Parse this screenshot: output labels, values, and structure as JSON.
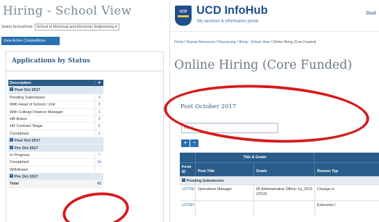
{
  "left": {
    "title": "Hiring - School View",
    "school_label": "Select School/Unit:",
    "school_value": "School of Electrical and Electronic Engineering",
    "view_active_button": "View Active Competitions",
    "apps_heading": "Applications by Status",
    "table": {
      "col_description": "Description",
      "col_count": "#",
      "rows": [
        {
          "type": "group",
          "label": "Post Oct 2017",
          "count": ""
        },
        {
          "type": "item",
          "label": "Pending Submission",
          "count": "3"
        },
        {
          "type": "item",
          "label": "With Head of School / Unit",
          "count": "3"
        },
        {
          "type": "item",
          "label": "With College Finance Manager",
          "count": "1"
        },
        {
          "type": "item",
          "label": "HR Active",
          "count": "3"
        },
        {
          "type": "item",
          "label": "HR Contract Stage",
          "count": "6"
        },
        {
          "type": "item",
          "label": "Completed",
          "count": "1"
        },
        {
          "type": "group",
          "label": "Post Oct 2017",
          "count": ""
        },
        {
          "type": "group",
          "label": "Pre Oct 2017",
          "count": ""
        },
        {
          "type": "item",
          "label": "In Progress",
          "count": "7"
        },
        {
          "type": "item",
          "label": "Completed",
          "count": "15"
        },
        {
          "type": "item",
          "label": "Withdrawn",
          "count": ""
        },
        {
          "type": "group",
          "label": "Pre Oct 2017",
          "count": ""
        },
        {
          "type": "total",
          "label": "Total",
          "count": "42"
        }
      ]
    }
  },
  "right": {
    "brand": "UCD InfoHub",
    "tagline": "My services & information portal",
    "crest_text": "UCD",
    "top_link": "Stud",
    "breadcrumb": {
      "home": "Home",
      "hr": "Human Resources",
      "resourcing": "Resourcing",
      "school_view": "Hiring - School View",
      "current": "Online Hiring (Core Funded)",
      "separator": "/"
    },
    "page_title": "Online Hiring (Core Funded)",
    "section_heading": "Post October 2017",
    "filter_placeholder": "Filter...",
    "buttons": {
      "expand": "+",
      "collapse": "−"
    },
    "table": {
      "title_header": "Title & Grade",
      "col_form_id": "Form ID",
      "col_post_title": "Post Title",
      "col_grade": "Grade",
      "col_reason": "Reason Typ",
      "group_label": "Pending Submission",
      "rows": [
        {
          "id": "137758",
          "post_title": "Operations Manager",
          "grade": "95 Administrative Officer 1a_2013 (2010)",
          "reason": "Change in"
        },
        {
          "id": "137587",
          "post_title": "",
          "grade": "",
          "reason": "Extension /"
        }
      ]
    }
  },
  "colors": {
    "accent_blue": "#2a6fb0",
    "header_navy": "#2a5d8a",
    "brand_blue": "#1f4e8c",
    "annotation_red": "#d51b1b"
  }
}
